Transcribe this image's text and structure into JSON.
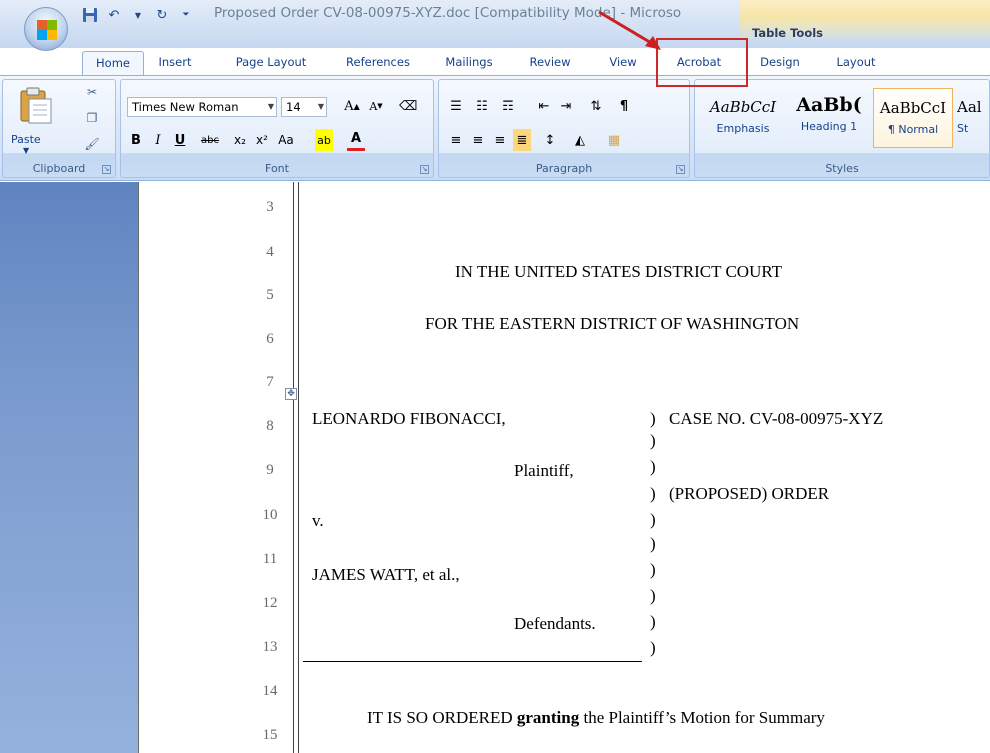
{
  "window": {
    "title": "Proposed Order CV-08-00975-XYZ.doc [Compatibility Mode] - Microso",
    "contextual_tab_group": "Table Tools"
  },
  "quick_access": [
    "save-icon",
    "undo-icon",
    "redo-icon",
    "customize-icon"
  ],
  "tabs": [
    {
      "label": "Home",
      "active": true
    },
    {
      "label": "Insert"
    },
    {
      "label": "Page Layout"
    },
    {
      "label": "References"
    },
    {
      "label": "Mailings"
    },
    {
      "label": "Review"
    },
    {
      "label": "View"
    },
    {
      "label": "Acrobat"
    },
    {
      "label": "Design"
    },
    {
      "label": "Layout"
    }
  ],
  "ribbon": {
    "clipboard": {
      "label": "Clipboard",
      "paste_label": "Paste"
    },
    "font": {
      "label": "Font",
      "font_name": "Times New Roman",
      "font_size": "14"
    },
    "paragraph": {
      "label": "Paragraph"
    },
    "styles": {
      "label": "Styles",
      "items": [
        {
          "sample": "AaBbCcI",
          "name": "Emphasis"
        },
        {
          "sample": "AaBb(",
          "name": "Heading 1"
        },
        {
          "sample": "AaBbCcI",
          "name": "¶ Normal",
          "selected": true
        },
        {
          "sample": "Aal",
          "name": "St"
        }
      ]
    }
  },
  "document": {
    "line_numbers": [
      "3",
      "4",
      "5",
      "6",
      "7",
      "8",
      "9",
      "10",
      "11",
      "12",
      "13",
      "14",
      "15"
    ],
    "court_line1": "IN THE UNITED STATES DISTRICT COURT",
    "court_line2": "FOR THE EASTERN DISTRICT OF WASHINGTON",
    "plaintiff_name": "LEONARDO FIBONACCI,",
    "plaintiff_role": "Plaintiff,",
    "versus": "v.",
    "defendant_name": "JAMES WATT, et al.,",
    "defendant_role": "Defendants.",
    "case_no": "CASE NO. CV-08-00975-XYZ",
    "order_title": "(PROPOSED)  ORDER",
    "order_text_pre": "IT IS SO ORDERED ",
    "order_text_bold": "granting",
    "order_text_post": " the Plaintiff’s Motion for Summary"
  }
}
